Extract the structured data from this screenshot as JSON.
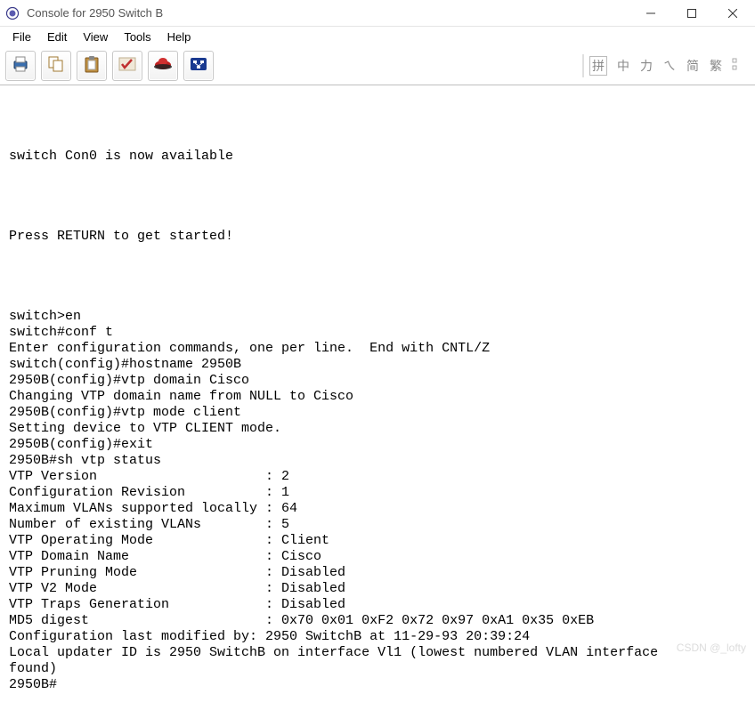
{
  "window": {
    "title": "Console for 2950 Switch B"
  },
  "menubar": {
    "file": "File",
    "edit": "Edit",
    "view": "View",
    "tools": "Tools",
    "help": "Help"
  },
  "toolbar": {
    "icons": {
      "print": "print-icon",
      "copy": "copy-icon",
      "paste": "paste-icon",
      "grade": "grade-icon",
      "redhat": "redhat-icon",
      "network": "network-icon"
    }
  },
  "ime": {
    "c1": "拼",
    "c2": "中",
    "c3": "力",
    "c4": "ㄟ",
    "c5": "简",
    "c6": "繁"
  },
  "console_text": "\n\nswitch Con0 is now available\n\n\n\n\nPress RETURN to get started!\n\n\n\n\nswitch>en\nswitch#conf t\nEnter configuration commands, one per line.  End with CNTL/Z\nswitch(config)#hostname 2950B\n2950B(config)#vtp domain Cisco\nChanging VTP domain name from NULL to Cisco\n2950B(config)#vtp mode client\nSetting device to VTP CLIENT mode.\n2950B(config)#exit\n2950B#sh vtp status\nVTP Version                     : 2\nConfiguration Revision          : 1\nMaximum VLANs supported locally : 64\nNumber of existing VLANs        : 5\nVTP Operating Mode              : Client\nVTP Domain Name                 : Cisco\nVTP Pruning Mode                : Disabled\nVTP V2 Mode                     : Disabled\nVTP Traps Generation            : Disabled\nMD5 digest                      : 0x70 0x01 0xF2 0x72 0x97 0xA1 0x35 0xEB\nConfiguration last modified by: 2950 SwitchB at 11-29-93 20:39:24\nLocal updater ID is 2950 SwitchB on interface Vl1 (lowest numbered VLAN interface\nfound)\n2950B#",
  "watermark": "CSDN @_lofty"
}
